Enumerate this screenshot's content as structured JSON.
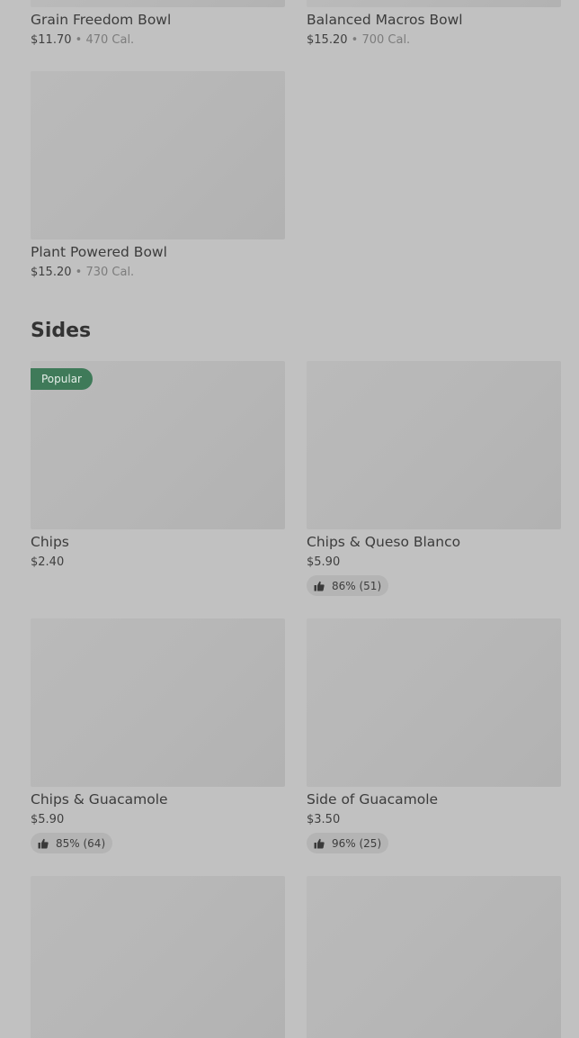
{
  "partial_row": [
    {
      "name": "Grain Freedom Bowl",
      "price": "$11.70",
      "sep": "•",
      "calories": "470 Cal."
    },
    {
      "name": "Balanced Macros Bowl",
      "price": "$15.20",
      "sep": "•",
      "calories": "700 Cal."
    }
  ],
  "bowl_single": {
    "name": "Plant Powered Bowl",
    "price": "$15.20",
    "sep": "•",
    "calories": "730 Cal."
  },
  "sides": {
    "title": "Sides",
    "items": [
      {
        "name": "Chips",
        "price": "$2.40",
        "badge": "Popular"
      },
      {
        "name": "Chips & Queso Blanco",
        "price": "$5.90",
        "rating": "86% (51)"
      },
      {
        "name": "Chips & Guacamole",
        "price": "$5.90",
        "rating": "85% (64)"
      },
      {
        "name": "Side of Guacamole",
        "price": "$3.50",
        "rating": "96% (25)"
      }
    ]
  },
  "icons": {
    "rating": "thumbs-up-icon"
  },
  "colors": {
    "badge_bg": "#3f7a59",
    "background": "#c1c1c1"
  }
}
